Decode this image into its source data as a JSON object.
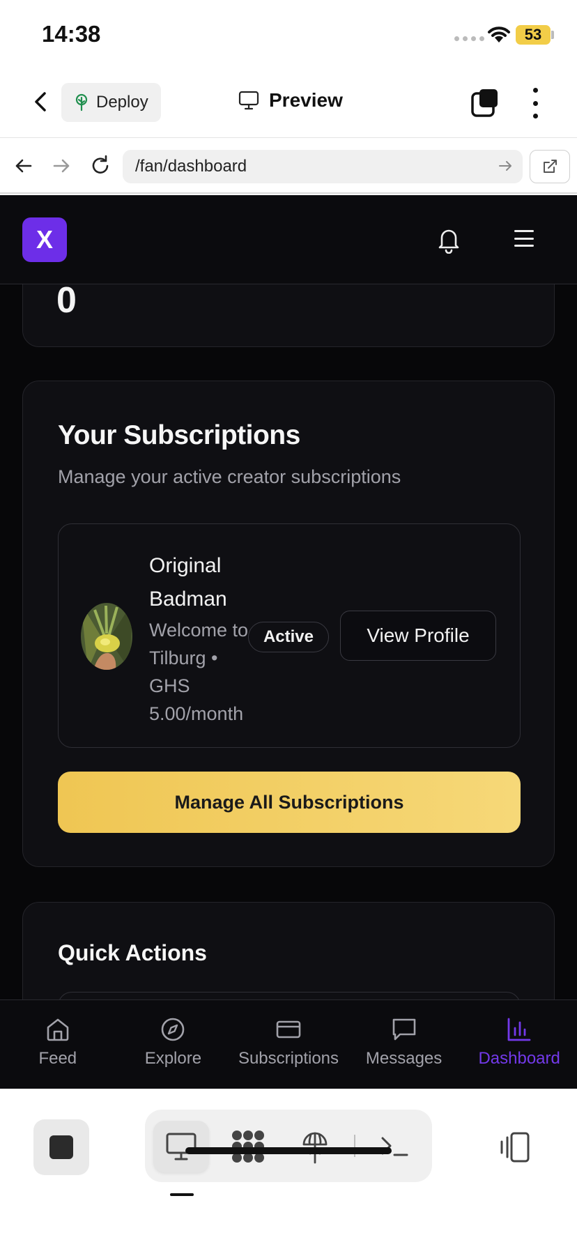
{
  "status": {
    "time": "14:38",
    "battery": "53"
  },
  "header": {
    "deploy_label": "Deploy",
    "preview_label": "Preview"
  },
  "browser": {
    "url": "/fan/dashboard"
  },
  "web": {
    "logo": "X",
    "top_card": {
      "value": "0"
    },
    "subscriptions": {
      "title": "Your Subscriptions",
      "description": "Manage your active creator subscriptions",
      "items": [
        {
          "name": "Original Badman",
          "meta": "Welcome to Tilburg • GHS 5.00/month",
          "status": "Active",
          "action": "View Profile"
        }
      ],
      "manage_label": "Manage All Subscriptions"
    },
    "quick_actions": {
      "title": "Quick Actions"
    }
  },
  "bottom_nav": [
    {
      "label": "Feed",
      "icon": "home-icon",
      "active": false
    },
    {
      "label": "Explore",
      "icon": "compass-icon",
      "active": false
    },
    {
      "label": "Subscriptions",
      "icon": "credit-card-icon",
      "active": false
    },
    {
      "label": "Messages",
      "icon": "message-icon",
      "active": false
    },
    {
      "label": "Dashboard",
      "icon": "bar-chart-icon",
      "active": true
    }
  ],
  "colors": {
    "accent": "#7339ea",
    "logo_bg": "#6d2ee8",
    "button_gold": "#efc653",
    "background": "#070709"
  }
}
